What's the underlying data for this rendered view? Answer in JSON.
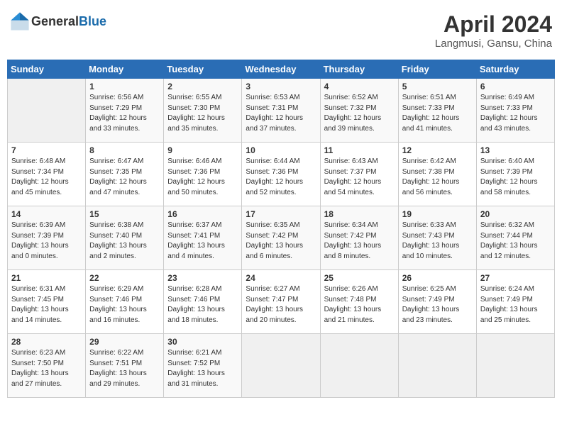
{
  "header": {
    "logo_general": "General",
    "logo_blue": "Blue",
    "month": "April 2024",
    "location": "Langmusi, Gansu, China"
  },
  "days_of_week": [
    "Sunday",
    "Monday",
    "Tuesday",
    "Wednesday",
    "Thursday",
    "Friday",
    "Saturday"
  ],
  "weeks": [
    [
      {
        "day": "",
        "sunrise": "",
        "sunset": "",
        "daylight": "",
        "empty": true
      },
      {
        "day": "1",
        "sunrise": "Sunrise: 6:56 AM",
        "sunset": "Sunset: 7:29 PM",
        "daylight": "Daylight: 12 hours and 33 minutes."
      },
      {
        "day": "2",
        "sunrise": "Sunrise: 6:55 AM",
        "sunset": "Sunset: 7:30 PM",
        "daylight": "Daylight: 12 hours and 35 minutes."
      },
      {
        "day": "3",
        "sunrise": "Sunrise: 6:53 AM",
        "sunset": "Sunset: 7:31 PM",
        "daylight": "Daylight: 12 hours and 37 minutes."
      },
      {
        "day": "4",
        "sunrise": "Sunrise: 6:52 AM",
        "sunset": "Sunset: 7:32 PM",
        "daylight": "Daylight: 12 hours and 39 minutes."
      },
      {
        "day": "5",
        "sunrise": "Sunrise: 6:51 AM",
        "sunset": "Sunset: 7:33 PM",
        "daylight": "Daylight: 12 hours and 41 minutes."
      },
      {
        "day": "6",
        "sunrise": "Sunrise: 6:49 AM",
        "sunset": "Sunset: 7:33 PM",
        "daylight": "Daylight: 12 hours and 43 minutes."
      }
    ],
    [
      {
        "day": "7",
        "sunrise": "Sunrise: 6:48 AM",
        "sunset": "Sunset: 7:34 PM",
        "daylight": "Daylight: 12 hours and 45 minutes."
      },
      {
        "day": "8",
        "sunrise": "Sunrise: 6:47 AM",
        "sunset": "Sunset: 7:35 PM",
        "daylight": "Daylight: 12 hours and 47 minutes."
      },
      {
        "day": "9",
        "sunrise": "Sunrise: 6:46 AM",
        "sunset": "Sunset: 7:36 PM",
        "daylight": "Daylight: 12 hours and 50 minutes."
      },
      {
        "day": "10",
        "sunrise": "Sunrise: 6:44 AM",
        "sunset": "Sunset: 7:36 PM",
        "daylight": "Daylight: 12 hours and 52 minutes."
      },
      {
        "day": "11",
        "sunrise": "Sunrise: 6:43 AM",
        "sunset": "Sunset: 7:37 PM",
        "daylight": "Daylight: 12 hours and 54 minutes."
      },
      {
        "day": "12",
        "sunrise": "Sunrise: 6:42 AM",
        "sunset": "Sunset: 7:38 PM",
        "daylight": "Daylight: 12 hours and 56 minutes."
      },
      {
        "day": "13",
        "sunrise": "Sunrise: 6:40 AM",
        "sunset": "Sunset: 7:39 PM",
        "daylight": "Daylight: 12 hours and 58 minutes."
      }
    ],
    [
      {
        "day": "14",
        "sunrise": "Sunrise: 6:39 AM",
        "sunset": "Sunset: 7:39 PM",
        "daylight": "Daylight: 13 hours and 0 minutes."
      },
      {
        "day": "15",
        "sunrise": "Sunrise: 6:38 AM",
        "sunset": "Sunset: 7:40 PM",
        "daylight": "Daylight: 13 hours and 2 minutes."
      },
      {
        "day": "16",
        "sunrise": "Sunrise: 6:37 AM",
        "sunset": "Sunset: 7:41 PM",
        "daylight": "Daylight: 13 hours and 4 minutes."
      },
      {
        "day": "17",
        "sunrise": "Sunrise: 6:35 AM",
        "sunset": "Sunset: 7:42 PM",
        "daylight": "Daylight: 13 hours and 6 minutes."
      },
      {
        "day": "18",
        "sunrise": "Sunrise: 6:34 AM",
        "sunset": "Sunset: 7:42 PM",
        "daylight": "Daylight: 13 hours and 8 minutes."
      },
      {
        "day": "19",
        "sunrise": "Sunrise: 6:33 AM",
        "sunset": "Sunset: 7:43 PM",
        "daylight": "Daylight: 13 hours and 10 minutes."
      },
      {
        "day": "20",
        "sunrise": "Sunrise: 6:32 AM",
        "sunset": "Sunset: 7:44 PM",
        "daylight": "Daylight: 13 hours and 12 minutes."
      }
    ],
    [
      {
        "day": "21",
        "sunrise": "Sunrise: 6:31 AM",
        "sunset": "Sunset: 7:45 PM",
        "daylight": "Daylight: 13 hours and 14 minutes."
      },
      {
        "day": "22",
        "sunrise": "Sunrise: 6:29 AM",
        "sunset": "Sunset: 7:46 PM",
        "daylight": "Daylight: 13 hours and 16 minutes."
      },
      {
        "day": "23",
        "sunrise": "Sunrise: 6:28 AM",
        "sunset": "Sunset: 7:46 PM",
        "daylight": "Daylight: 13 hours and 18 minutes."
      },
      {
        "day": "24",
        "sunrise": "Sunrise: 6:27 AM",
        "sunset": "Sunset: 7:47 PM",
        "daylight": "Daylight: 13 hours and 20 minutes."
      },
      {
        "day": "25",
        "sunrise": "Sunrise: 6:26 AM",
        "sunset": "Sunset: 7:48 PM",
        "daylight": "Daylight: 13 hours and 21 minutes."
      },
      {
        "day": "26",
        "sunrise": "Sunrise: 6:25 AM",
        "sunset": "Sunset: 7:49 PM",
        "daylight": "Daylight: 13 hours and 23 minutes."
      },
      {
        "day": "27",
        "sunrise": "Sunrise: 6:24 AM",
        "sunset": "Sunset: 7:49 PM",
        "daylight": "Daylight: 13 hours and 25 minutes."
      }
    ],
    [
      {
        "day": "28",
        "sunrise": "Sunrise: 6:23 AM",
        "sunset": "Sunset: 7:50 PM",
        "daylight": "Daylight: 13 hours and 27 minutes."
      },
      {
        "day": "29",
        "sunrise": "Sunrise: 6:22 AM",
        "sunset": "Sunset: 7:51 PM",
        "daylight": "Daylight: 13 hours and 29 minutes."
      },
      {
        "day": "30",
        "sunrise": "Sunrise: 6:21 AM",
        "sunset": "Sunset: 7:52 PM",
        "daylight": "Daylight: 13 hours and 31 minutes."
      },
      {
        "day": "",
        "sunrise": "",
        "sunset": "",
        "daylight": "",
        "empty": true
      },
      {
        "day": "",
        "sunrise": "",
        "sunset": "",
        "daylight": "",
        "empty": true
      },
      {
        "day": "",
        "sunrise": "",
        "sunset": "",
        "daylight": "",
        "empty": true
      },
      {
        "day": "",
        "sunrise": "",
        "sunset": "",
        "daylight": "",
        "empty": true
      }
    ]
  ]
}
